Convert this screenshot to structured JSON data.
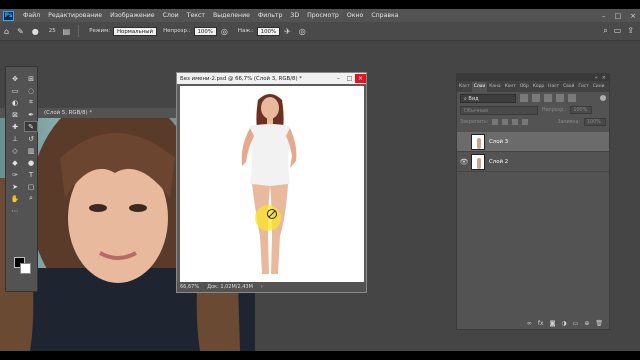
{
  "menubar": {
    "logo": "Ps",
    "items": [
      "Файл",
      "Редактирование",
      "Изображение",
      "Слои",
      "Текст",
      "Выделение",
      "Фильтр",
      "3D",
      "Просмотр",
      "Окно",
      "Справка"
    ],
    "controls": [
      "–",
      "□",
      "×"
    ]
  },
  "options": {
    "brush_size": "25",
    "mode_label": "Режим:",
    "mode_value": "Нормальный",
    "opacity_label": "Непрозр.:",
    "opacity_value": "100%",
    "flow_label": "Наж.:",
    "flow_value": "100%"
  },
  "photo_doc": {
    "title": "(Слой 5, RGB/8) *"
  },
  "document": {
    "title": "Без имени-2.psd @ 66,7% (Слой 3, RGB/8) *",
    "zoom": "66,67%",
    "info": "Док: 1,02M/2,43M"
  },
  "layers_panel": {
    "tabs": [
      "Каст",
      "Слои",
      "Кана",
      "Конт",
      "Обр",
      "Корр",
      "Наст",
      "Свой",
      "Гист",
      "Сини"
    ],
    "active_tab": "Слои",
    "filter_value": "Вид",
    "blend_mode": "Обычные",
    "opacity_label": "Непрозр.:",
    "opacity_value": "100%",
    "lock_label": "Закрепить:",
    "fill_label": "Заливка:",
    "fill_value": "100%",
    "layers": [
      {
        "name": "Слой 3",
        "visible": false,
        "selected": true
      },
      {
        "name": "Слой 2",
        "visible": true,
        "selected": false
      }
    ],
    "bottom_icons": [
      "link-icon",
      "fx-icon",
      "mask-icon",
      "adjustment-icon",
      "group-icon",
      "new-layer-icon",
      "trash-icon"
    ]
  },
  "colors": {
    "foreground": "#000000",
    "background": "#ffffff",
    "ui_dark": "#535353",
    "workspace": "#454545"
  }
}
